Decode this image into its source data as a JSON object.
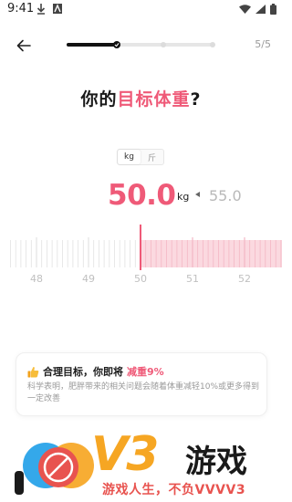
{
  "status_bar": {
    "time": "9:41"
  },
  "header": {
    "back_icon": "arrow-left-icon",
    "step_count": "5/5",
    "progress_fraction": 0.34
  },
  "title": {
    "prefix": "你的",
    "highlight": "目标体重",
    "suffix": "?"
  },
  "unit_toggle": {
    "options": [
      "kg",
      "斤"
    ],
    "selected": "kg"
  },
  "weight": {
    "target": "50.0",
    "unit": "kg",
    "current": "55.0"
  },
  "ruler": {
    "labels": [
      "48",
      "49",
      "50",
      "51",
      "52"
    ],
    "selected_value": 50,
    "min_visible": 47.5,
    "max_visible": 52.7
  },
  "tip_card": {
    "icon": "thumbs-up-icon",
    "head_prefix": "合理目标，你即将",
    "head_highlight": "减重9%",
    "body": "科学表明，肥胖带来的相关问题会随着体重减轻10%或更多得到一定改善"
  },
  "watermark": {
    "brand": "V3",
    "brand_cn": "游戏",
    "tagline": "游戏人生，不负VVVV3"
  },
  "colors": {
    "accent": "#ef5a78",
    "accent_soft": "#fbd9e0",
    "brand_orange": "#f6a623"
  }
}
